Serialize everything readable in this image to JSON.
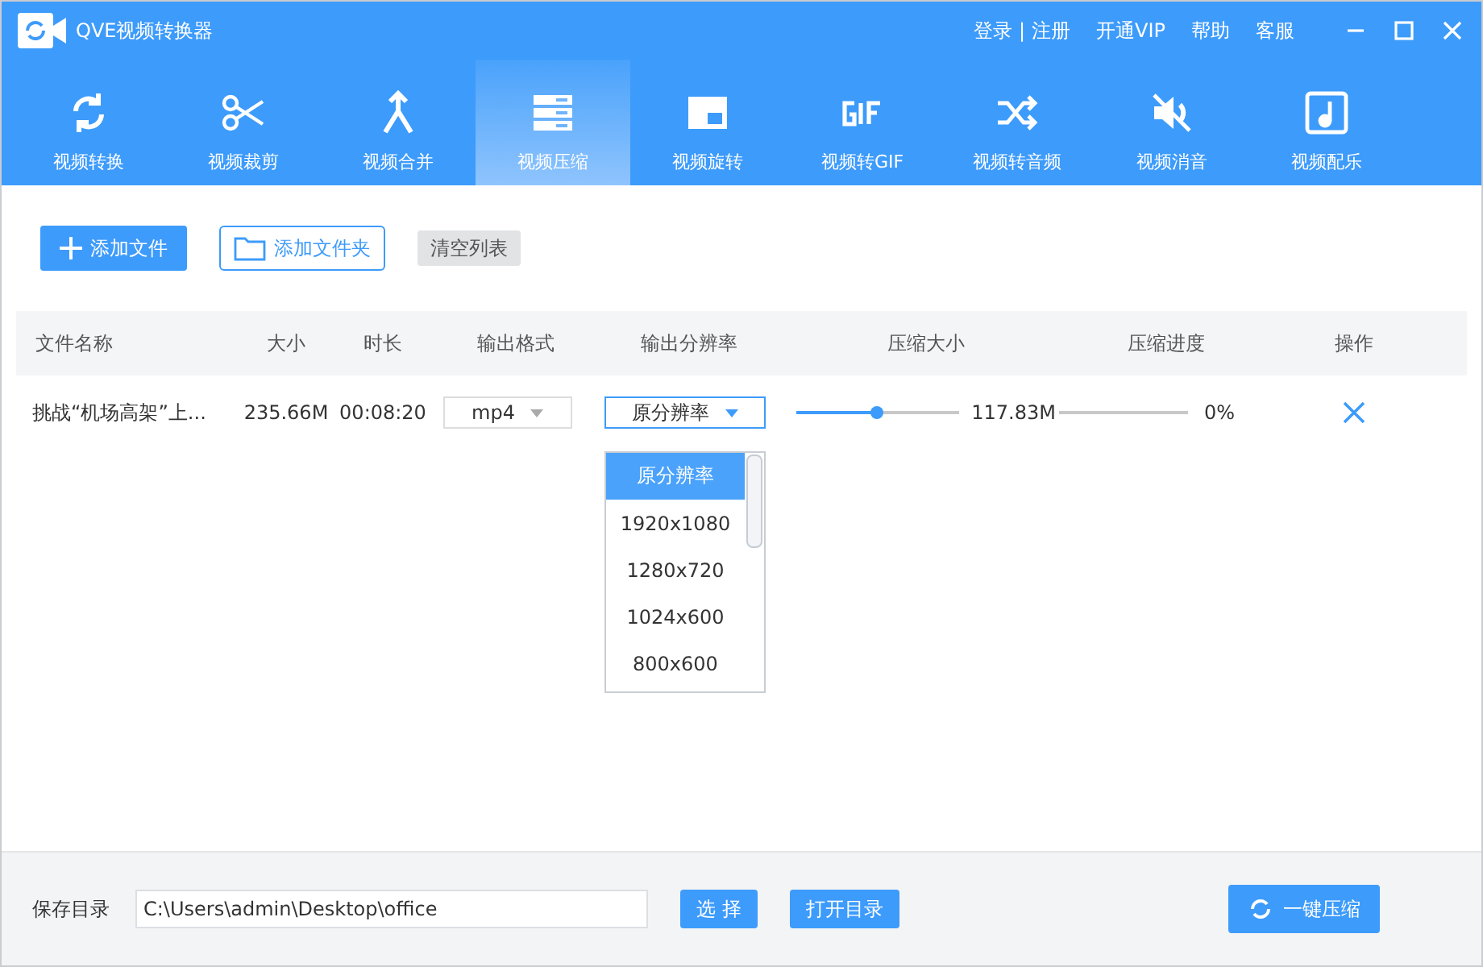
{
  "window": {
    "title": "QVE视频转换器",
    "links": [
      "登录",
      "注册",
      "开通VIP",
      "帮助",
      "客服"
    ],
    "separator": "|"
  },
  "tabs": [
    {
      "label": "视频转换",
      "selected": false
    },
    {
      "label": "视频裁剪",
      "selected": false
    },
    {
      "label": "视频合并",
      "selected": false
    },
    {
      "label": "视频压缩",
      "selected": true
    },
    {
      "label": "视频旋转",
      "selected": false
    },
    {
      "label": "视频转GIF",
      "selected": false
    },
    {
      "label": "视频转音频",
      "selected": false
    },
    {
      "label": "视频消音",
      "selected": false
    },
    {
      "label": "视频配乐",
      "selected": false
    }
  ],
  "toolbar": {
    "add_file": "添加文件",
    "add_folder": "添加文件夹",
    "clear": "清空列表"
  },
  "table": {
    "columns": [
      "文件名称",
      "大小",
      "时长",
      "输出格式",
      "输出分辨率",
      "压缩大小",
      "压缩进度",
      "操作"
    ],
    "rows": [
      {
        "name": "挑战“机场高架”上...",
        "size": "235.66M",
        "duration": "00:08:20",
        "format": "mp4",
        "resolution": "原分辨率",
        "level": 0.5,
        "compressed_size": "117.83M",
        "progress": {
          "level": 0,
          "reading": "0%"
        }
      }
    ]
  },
  "dropdown": {
    "expanded": true,
    "options": [
      {
        "label": "原分辨率",
        "selected": true
      },
      {
        "label": "1920x1080",
        "selected": false
      },
      {
        "label": "1280x720",
        "selected": false
      },
      {
        "label": "1024x600",
        "selected": false
      },
      {
        "label": "800x600",
        "selected": false
      }
    ]
  },
  "footer": {
    "label": "保存目录",
    "path": "C:\\Users\\admin\\Desktop\\office",
    "choose": "选 择",
    "open": "打开目录",
    "start": "一键压缩"
  }
}
